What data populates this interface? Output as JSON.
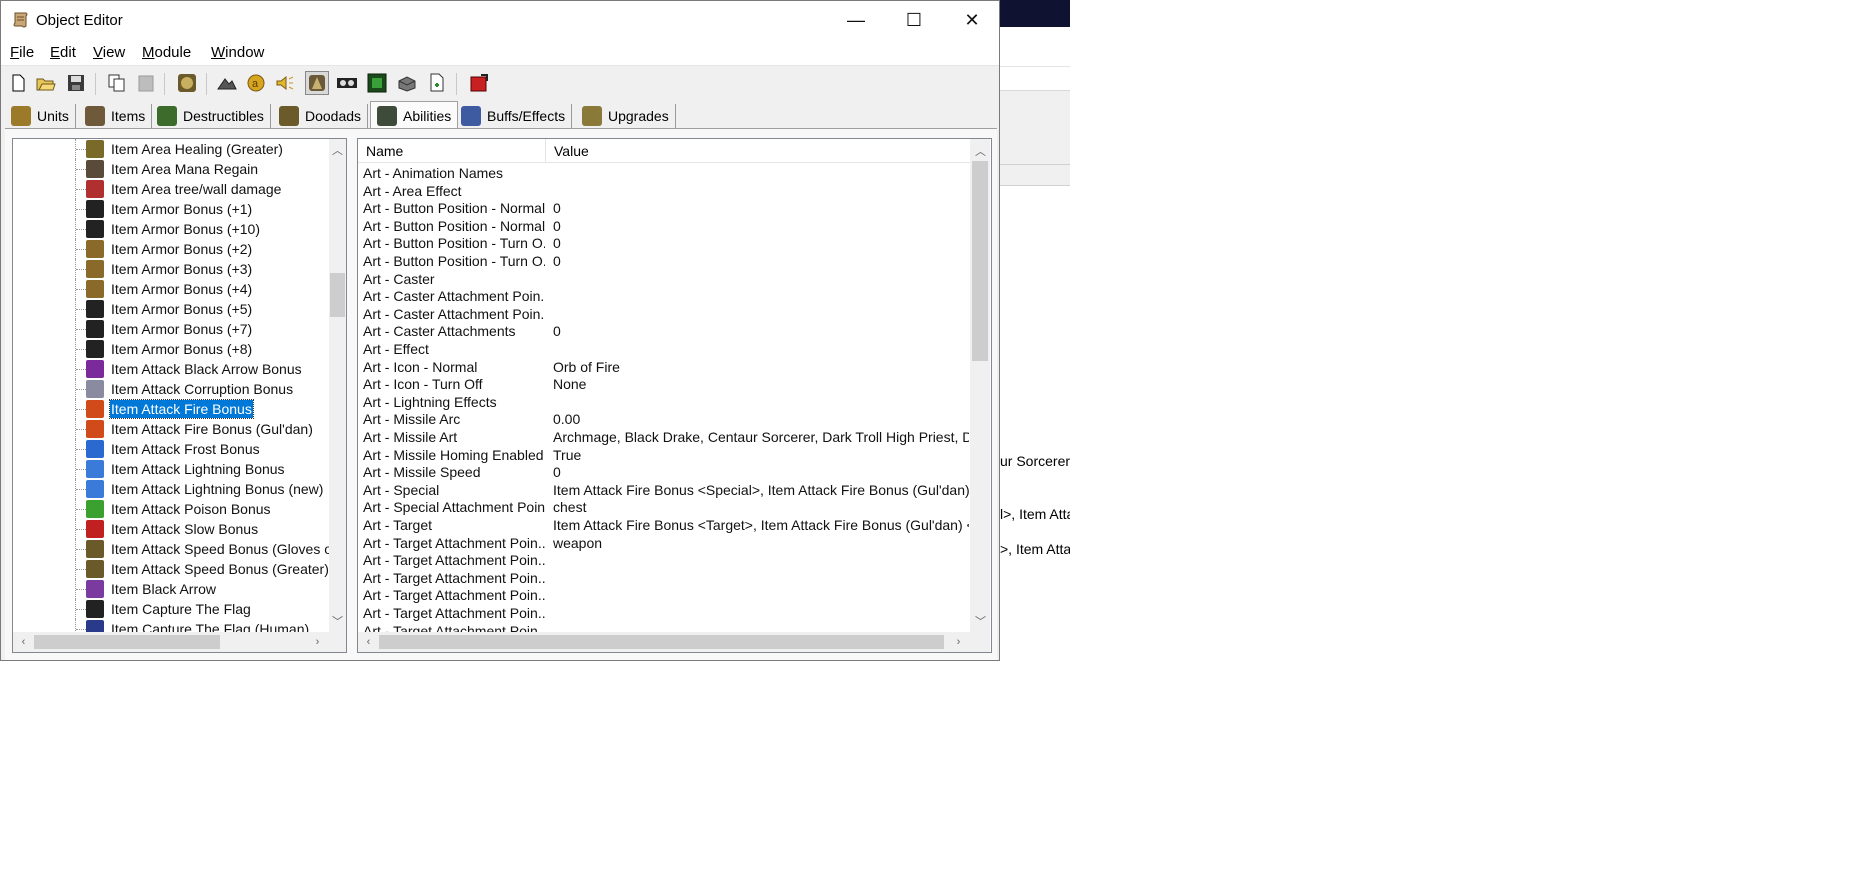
{
  "window": {
    "title": "Object Editor",
    "controls": {
      "minimize": "—",
      "maximize": "☐",
      "close": "✕"
    }
  },
  "menu": [
    "File",
    "Edit",
    "View",
    "Module",
    "Window"
  ],
  "toolbar_icons": [
    "new-file-icon",
    "open-folder-icon",
    "save-icon",
    "copy-icon",
    "paste-icon",
    "unit-editor-icon",
    "terrain-icon",
    "gold-icon",
    "sound-icon",
    "object-editor-icon",
    "camera-icon",
    "ai-editor-icon",
    "import-icon",
    "export-icon",
    "test-map-icon"
  ],
  "tabs": [
    {
      "label": "Units",
      "color": "#9b7a2a"
    },
    {
      "label": "Items",
      "color": "#6e5a3a"
    },
    {
      "label": "Destructibles",
      "color": "#3d6b2b"
    },
    {
      "label": "Doodads",
      "color": "#6b5b2b"
    },
    {
      "label": "Abilities",
      "color": "#3e4a3a",
      "active": true
    },
    {
      "label": "Buffs/Effects",
      "color": "#3e5aa0"
    },
    {
      "label": "Upgrades",
      "color": "#8a7a3a"
    }
  ],
  "tree": {
    "selected_index": 13,
    "items": [
      {
        "label": "Item Area Healing (Greater)",
        "color": "#7a6a2a"
      },
      {
        "label": "Item Area Mana Regain",
        "color": "#5a4a3a"
      },
      {
        "label": "Item Area tree/wall damage",
        "color": "#b03030"
      },
      {
        "label": "Item Armor Bonus (+1)",
        "color": "#222222"
      },
      {
        "label": "Item Armor Bonus (+10)",
        "color": "#222222"
      },
      {
        "label": "Item Armor Bonus (+2)",
        "color": "#8a6a2a"
      },
      {
        "label": "Item Armor Bonus (+3)",
        "color": "#8a6a2a"
      },
      {
        "label": "Item Armor Bonus (+4)",
        "color": "#8a6a2a"
      },
      {
        "label": "Item Armor Bonus (+5)",
        "color": "#222222"
      },
      {
        "label": "Item Armor Bonus (+7)",
        "color": "#222222"
      },
      {
        "label": "Item Armor Bonus (+8)",
        "color": "#222222"
      },
      {
        "label": "Item Attack Black Arrow Bonus",
        "color": "#7a2a9a"
      },
      {
        "label": "Item Attack Corruption Bonus",
        "color": "#8a8aa0"
      },
      {
        "label": "Item Attack Fire Bonus",
        "color": "#d04a1a"
      },
      {
        "label": "Item Attack Fire Bonus (Gul'dan)",
        "color": "#d04a1a"
      },
      {
        "label": "Item Attack Frost Bonus",
        "color": "#2a6ad0"
      },
      {
        "label": "Item Attack Lightning Bonus",
        "color": "#3a7ad8"
      },
      {
        "label": "Item Attack Lightning Bonus (new)",
        "color": "#3a7ad8"
      },
      {
        "label": "Item Attack Poison Bonus",
        "color": "#3aa030"
      },
      {
        "label": "Item Attack Slow Bonus",
        "color": "#c02020"
      },
      {
        "label": "Item Attack Speed Bonus (Gloves of",
        "color": "#6a5a2a"
      },
      {
        "label": "Item Attack Speed Bonus (Greater)",
        "color": "#6a5a2a"
      },
      {
        "label": "Item Black Arrow",
        "color": "#7a3aa0"
      },
      {
        "label": "Item Capture The Flag",
        "color": "#222222"
      },
      {
        "label": "Item Capture The Flag (Human)",
        "color": "#2a3a8a"
      }
    ]
  },
  "props": {
    "header_name": "Name",
    "header_value": "Value",
    "rows": [
      {
        "name": "Art - Animation Names",
        "value": ""
      },
      {
        "name": "Art - Area Effect",
        "value": ""
      },
      {
        "name": "Art - Button Position - Normal...",
        "value": "0"
      },
      {
        "name": "Art - Button Position - Normal...",
        "value": "0"
      },
      {
        "name": "Art - Button Position - Turn O...",
        "value": "0"
      },
      {
        "name": "Art - Button Position - Turn O...",
        "value": "0"
      },
      {
        "name": "Art - Caster",
        "value": ""
      },
      {
        "name": "Art - Caster Attachment Poin...",
        "value": ""
      },
      {
        "name": "Art - Caster Attachment Poin...",
        "value": ""
      },
      {
        "name": "Art - Caster Attachments",
        "value": "0"
      },
      {
        "name": "Art - Effect",
        "value": ""
      },
      {
        "name": "Art - Icon - Normal",
        "value": "Orb of Fire"
      },
      {
        "name": "Art - Icon - Turn Off",
        "value": "None"
      },
      {
        "name": "Art - Lightning Effects",
        "value": ""
      },
      {
        "name": "Art - Missile Arc",
        "value": "0.00"
      },
      {
        "name": "Art - Missile Art",
        "value": "Archmage, Black Drake, Centaur Sorcerer, Dark Troll High Priest, D..."
      },
      {
        "name": "Art - Missile Homing Enabled",
        "value": "True"
      },
      {
        "name": "Art - Missile Speed",
        "value": "0"
      },
      {
        "name": "Art - Special",
        "value": "Item Attack Fire Bonus <Special>, Item Attack Fire Bonus (Gul'dan) ..."
      },
      {
        "name": "Art - Special Attachment Point",
        "value": "chest"
      },
      {
        "name": "Art - Target",
        "value": "Item Attack Fire Bonus <Target>, Item Attack Fire Bonus (Gul'dan) <..."
      },
      {
        "name": "Art - Target Attachment Poin...",
        "value": "weapon"
      },
      {
        "name": "Art - Target Attachment Poin...",
        "value": ""
      },
      {
        "name": "Art - Target Attachment Poin...",
        "value": ""
      },
      {
        "name": "Art - Target Attachment Poin...",
        "value": ""
      },
      {
        "name": "Art - Target Attachment Poin...",
        "value": ""
      },
      {
        "name": "Art - Target Attachment Poin...",
        "value": ""
      }
    ]
  },
  "background_window_fragments": [
    "ur Sorcerer,",
    "l>, Item Atta",
    ">, Item Atta"
  ]
}
